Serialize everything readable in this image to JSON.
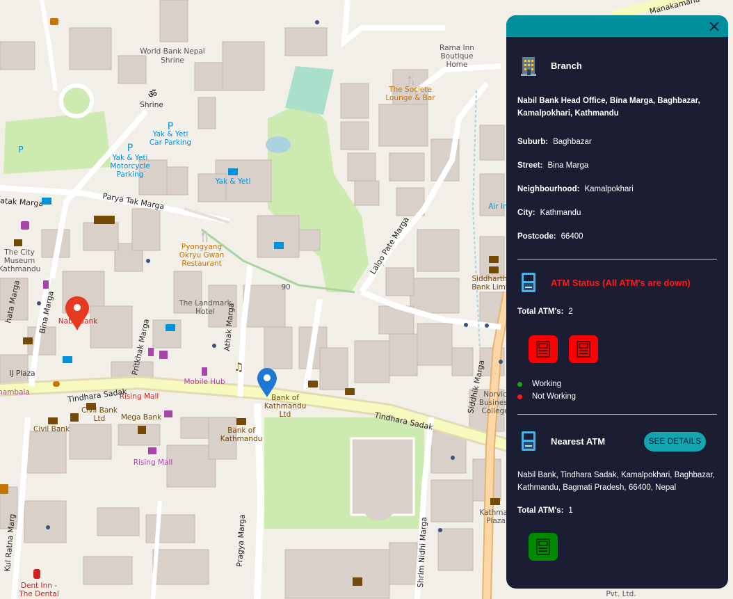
{
  "map": {
    "street_labels": [
      "Tindhara Sadak",
      "Tindhara Sadak",
      "Parya Tak Marga",
      "atak Marga",
      "Bina Marga",
      "Pritkhak Marga",
      "Athak Marga",
      "Laloo Pate Marga",
      "Siddhik Marga",
      "Pragya Marga",
      "Shrim Nidhi Marga",
      "Kul Ratna Marg",
      "Manakamana",
      "hata Marga"
    ],
    "poi_labels": [
      "World Bank Nepal",
      "Shrine",
      "Yak & Yeti Car Parking",
      "Yak & Yeti Motorcycle Parking",
      "Yak & Yeti",
      "Pyongyang Okryu Gwan Restaurant",
      "The City Museum Kathmandu",
      "Nabil Bank",
      "The Landmark Hotel",
      "IJ Plaza",
      "Rising Mall",
      "Mobile Hub",
      "Bank of Kathmandu Ltd",
      "Civil Bank Ltd",
      "Civil Bank",
      "Mega Bank",
      "Bank of Kathmandu",
      "Rising Mall",
      "Rama Inn Boutique Home",
      "The Societe Lounge & Bar",
      "Siddharth Bank Limi",
      "Air In",
      "Norvic Business College",
      "Kathman Plaza",
      "Dent Inn - The Dental",
      "90",
      "hambala",
      "Pvt. Ltd."
    ]
  },
  "panel": {
    "branch": {
      "title": "Branch",
      "icon": "building-icon",
      "address": "Nabil Bank Head Office, Bina Marga, Baghbazar, Kamalpokhari, Kathmandu",
      "fields": [
        {
          "key": "Suburb:",
          "value": "Baghbazar"
        },
        {
          "key": "Street:",
          "value": "Bina Marga"
        },
        {
          "key": "Neighbourhood:",
          "value": "Kamalpokhari"
        },
        {
          "key": "City:",
          "value": "Kathmandu"
        },
        {
          "key": "Postcode:",
          "value": "66400"
        }
      ]
    },
    "atm_status": {
      "title": "ATM Status (All ATM's are down)",
      "title_color": "#ff1a1a",
      "total_label": "Total ATM's:",
      "total_value": "2",
      "atms": [
        {
          "status": "not-working"
        },
        {
          "status": "not-working"
        }
      ],
      "legend": [
        {
          "label": "Working",
          "color": "#1aa51a"
        },
        {
          "label": "Not Working",
          "color": "#ff1a1a"
        }
      ]
    },
    "nearest_atm": {
      "title": "Nearest ATM",
      "button_label": "SEE DETAILS",
      "address": "Nabil Bank, Tindhara Sadak, Kamalpokhari, Baghbazar, Kathmandu, Bagmati Pradesh, 66400, Nepal",
      "total_label": "Total ATM's:",
      "total_value": "1",
      "atms": [
        {
          "status": "working"
        }
      ]
    },
    "colors": {
      "header": "#008f9c",
      "background": "#1b1d33",
      "atm_down": "#ff0000",
      "atm_up": "#008a00",
      "accent": "#14a5b1"
    }
  }
}
